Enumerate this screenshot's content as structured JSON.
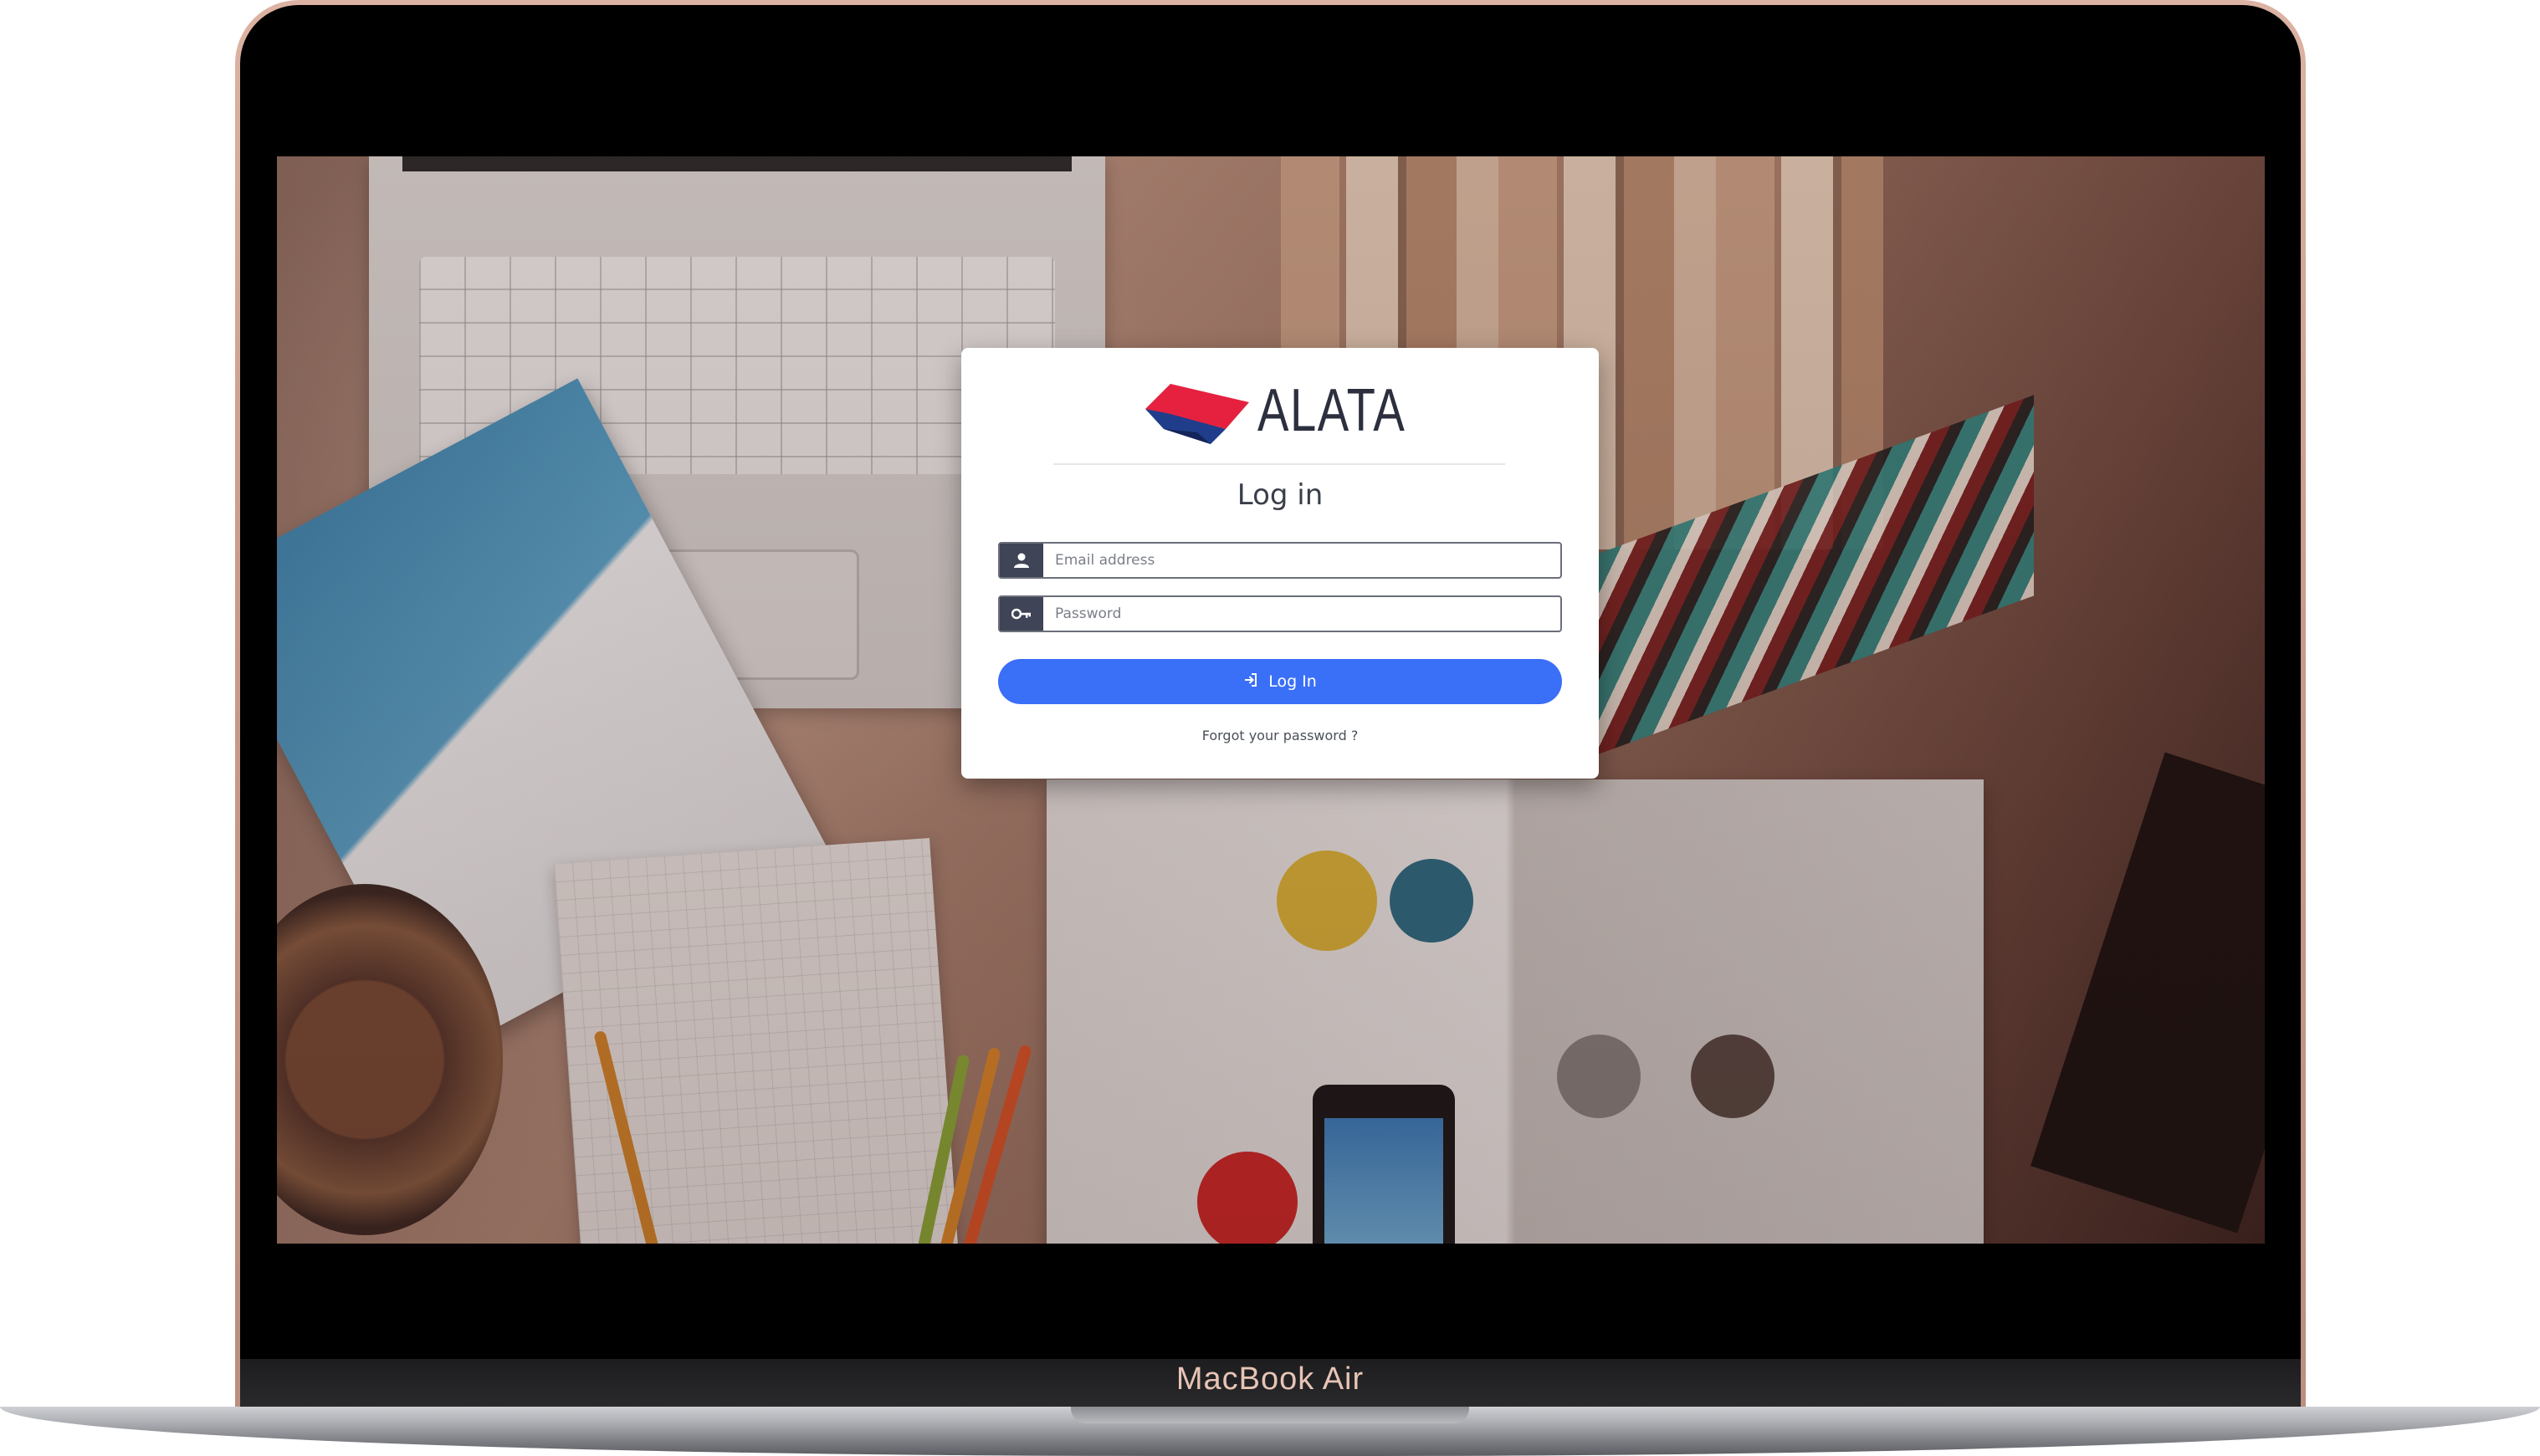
{
  "device": {
    "model_label": "MacBook Air"
  },
  "login": {
    "brand_name": "ALATA",
    "title": "Log in",
    "email_placeholder": "Email address",
    "password_placeholder": "Password",
    "submit_label": "Log In",
    "forgot_label": "Forgot your password ?"
  },
  "icons": {
    "email_field": "user-icon",
    "password_field": "key-icon",
    "submit": "sign-in-icon"
  },
  "colors": {
    "primary_button": "#3a6ff7",
    "field_addon": "#3f4456",
    "brand_red": "#e5213f",
    "brand_navy": "#2c2f3e"
  }
}
